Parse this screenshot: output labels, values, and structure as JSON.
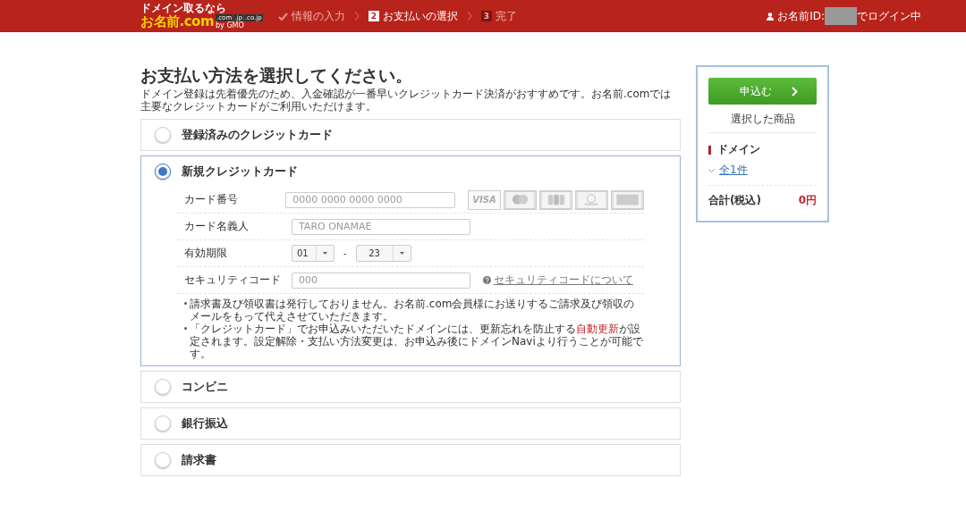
{
  "header": {
    "logo": {
      "tagline": "ドメイン取るなら",
      "name": "お名前.com",
      "domains": [
        ".com",
        ".jp",
        ".co.jp"
      ],
      "by": "by GMO"
    },
    "steps": [
      {
        "label": "情報の入力",
        "kind": "done"
      },
      {
        "number": "2",
        "label": "お支払いの選択",
        "kind": "current"
      },
      {
        "number": "3",
        "label": "完了",
        "kind": "upcoming"
      }
    ],
    "user": {
      "prefix": "お名前ID:",
      "suffix": "でログイン中"
    }
  },
  "title": "お支払い方法を選択してください。",
  "lead": "ドメイン登録は先着優先のため、入金確認が一番早いクレジットカード決済がおすすめです。お名前.comでは主要なクレジットカードがご利用いただけます。",
  "methods": [
    {
      "label": "登録済みのクレジットカード",
      "selected": false
    },
    {
      "label": "新規クレジットカード",
      "selected": true,
      "form": {
        "rows": [
          {
            "kind": "text",
            "label": "カード番号",
            "placeholder": "0000 0000 0000 0000",
            "brands": [
              {
                "kind": "visa",
                "label": "VISA"
              },
              {
                "kind": "mastercard"
              },
              {
                "kind": "jcb"
              },
              {
                "kind": "diners"
              },
              {
                "kind": "amex"
              }
            ]
          },
          {
            "kind": "text",
            "label": "カード名義人",
            "placeholder": "TARO ONAMAE"
          },
          {
            "kind": "expiry",
            "label": "有効期限",
            "month": "01",
            "separator": "-",
            "year": "23"
          },
          {
            "kind": "text",
            "label": "セキュリティコード",
            "placeholder": "000",
            "help": "セキュリティコードについて"
          }
        ],
        "notes": [
          {
            "before": "請求書及び領収書は発行しておりません。お名前.com会員様にお送りするご請求及び領収のメールをもって代えさせていただきます。"
          },
          {
            "before": "「クレジットカード」でお申込みいただいたドメインには、更新忘れを防止する",
            "highlight": "自動更新",
            "after": "が設定されます。設定解除・支払い方法変更は、お申込み後にドメインNaviより行うことが可能です。"
          }
        ]
      }
    },
    {
      "label": "コンビニ",
      "selected": false
    },
    {
      "label": "銀行振込",
      "selected": false
    },
    {
      "label": "請求書",
      "selected": false
    }
  ],
  "sidebar": {
    "button": "申込む",
    "heading": "選択した商品",
    "category": "ドメイン",
    "toggle": "全1件",
    "total_label": "合計(税込)",
    "total": "0円"
  }
}
